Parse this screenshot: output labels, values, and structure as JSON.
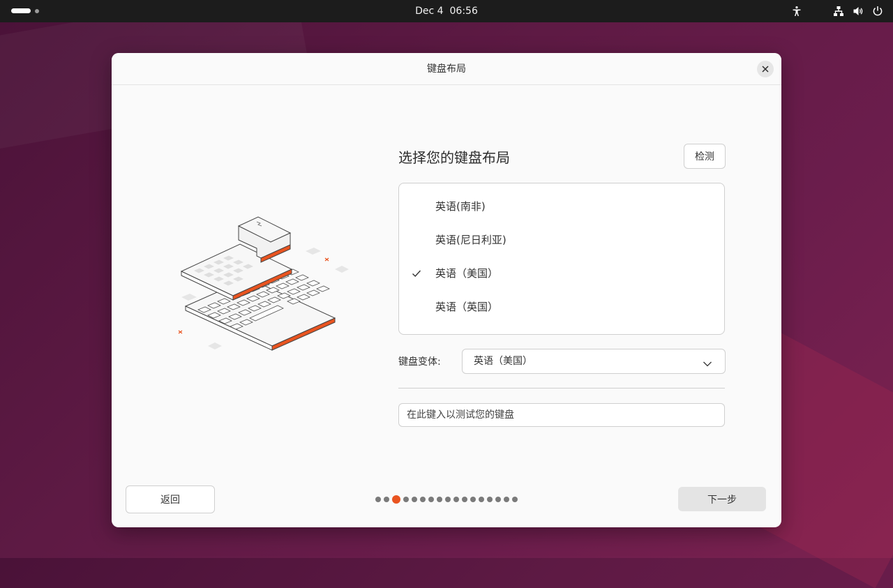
{
  "topbar": {
    "date": "Dec 4",
    "time": "06:56",
    "icons": [
      "accessibility-icon",
      "network-icon",
      "volume-icon",
      "power-icon"
    ]
  },
  "dialog": {
    "title": "键盘布局",
    "heading": "选择您的键盘布局",
    "detect_label": "检测",
    "layouts": [
      {
        "label": "英语(南非)",
        "selected": false
      },
      {
        "label": "英语(尼日利亚)",
        "selected": false
      },
      {
        "label": "英语（美国）",
        "selected": true
      },
      {
        "label": "英语（英国）",
        "selected": false
      }
    ],
    "variant_label": "键盘变体:",
    "variant_value": "英语（美国）",
    "test_placeholder": "在此键入以测试您的键盘",
    "back_label": "返回",
    "next_label": "下一步",
    "steps_total": 17,
    "current_step": 3
  },
  "colors": {
    "accent": "#e95420",
    "topbar": "#1c1c1c",
    "dialog_bg": "#fafafa"
  }
}
